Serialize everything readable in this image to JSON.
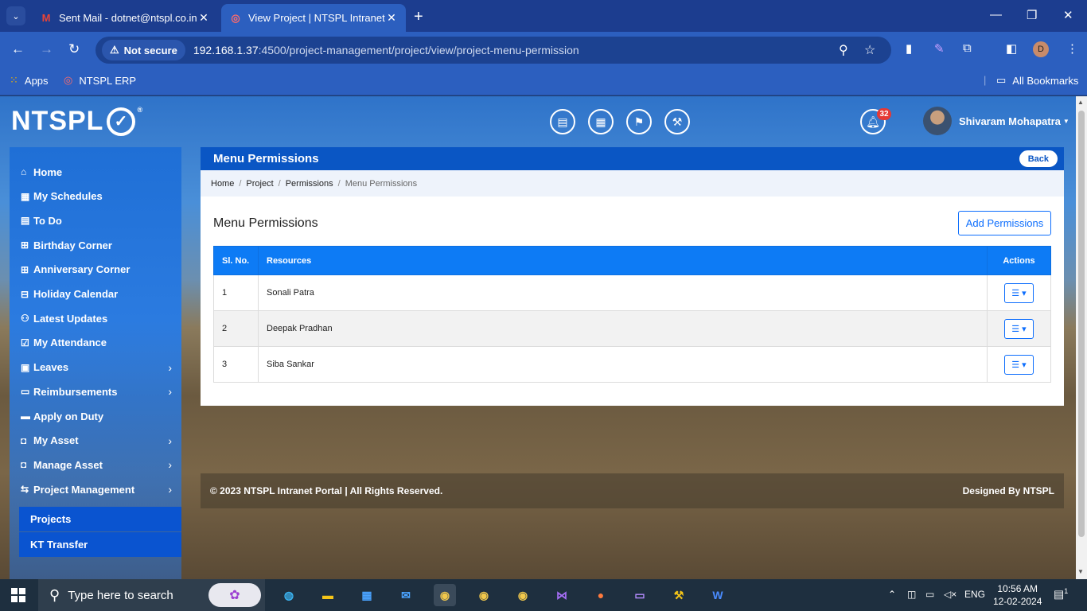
{
  "browser": {
    "tabs": [
      {
        "title": "Sent Mail - dotnet@ntspl.co.in",
        "favicon": "gmail-icon"
      },
      {
        "title": "View Project | NTSPL Intranet",
        "favicon": "ntspl-icon"
      }
    ],
    "security_label": "Not secure",
    "url_host": "192.168.1.37",
    "url_rest": ":4500/project-management/project/view/project-menu-permission",
    "profile_initial": "D",
    "bookmarks": [
      {
        "label": "Apps"
      },
      {
        "label": "NTSPL ERP"
      }
    ],
    "all_bookmarks": "All Bookmarks"
  },
  "header": {
    "logo_text": "NTSPL",
    "logo_reg": "®",
    "notification_count": "32",
    "user_name": "Shivaram Mohapatra"
  },
  "sidebar": {
    "items": [
      {
        "label": "Home",
        "icon": "home-icon",
        "glyph": "⌂"
      },
      {
        "label": "My Schedules",
        "icon": "calendar-icon",
        "glyph": "▦"
      },
      {
        "label": "To Do",
        "icon": "todo-icon",
        "glyph": "▤"
      },
      {
        "label": "Birthday Corner",
        "icon": "gift-icon",
        "glyph": "⊞"
      },
      {
        "label": "Anniversary Corner",
        "icon": "gift-icon",
        "glyph": "⊞"
      },
      {
        "label": "Holiday Calendar",
        "icon": "table-calendar-icon",
        "glyph": "⊟"
      },
      {
        "label": "Latest Updates",
        "icon": "people-icon",
        "glyph": "⚇"
      },
      {
        "label": "My Attendance",
        "icon": "calendar-check-icon",
        "glyph": "☑"
      },
      {
        "label": "Leaves",
        "icon": "calendar-x-icon",
        "glyph": "▣"
      },
      {
        "label": "Reimbursements",
        "icon": "cash-icon",
        "glyph": "▭"
      },
      {
        "label": "Apply on Duty",
        "icon": "briefcase-icon",
        "glyph": "▬"
      },
      {
        "label": "My Asset",
        "icon": "bag-icon",
        "glyph": "◘"
      },
      {
        "label": "Manage Asset",
        "icon": "bag-icon",
        "glyph": "◘"
      },
      {
        "label": "Project Management",
        "icon": "arrows-icon",
        "glyph": "⇆"
      }
    ],
    "sub_items": [
      {
        "label": "Projects"
      },
      {
        "label": "KT Transfer"
      }
    ]
  },
  "content": {
    "panel_title": "Menu Permissions",
    "back_label": "Back",
    "breadcrumb": [
      "Home",
      "Project",
      "Permissions",
      "Menu Permissions"
    ],
    "card_title": "Menu Permissions",
    "add_button": "Add Permissions",
    "table": {
      "headers": [
        "Sl. No.",
        "Resources",
        "Actions"
      ],
      "rows": [
        {
          "sl": "1",
          "resource": "Sonali Patra"
        },
        {
          "sl": "2",
          "resource": "Deepak Pradhan"
        },
        {
          "sl": "3",
          "resource": "Siba Sankar"
        }
      ]
    }
  },
  "footer": {
    "copyright": "© 2023 NTSPL Intranet Portal | All Rights Reserved.",
    "designed_by": "Designed By NTSPL"
  },
  "taskbar": {
    "search_placeholder": "Type here to search",
    "language": "ENG",
    "time": "10:56 AM",
    "date": "12-02-2024",
    "notification_count": "1"
  },
  "colors": {
    "primary": "#0d6efd",
    "header_blue": "#0a56c4",
    "sidebar_active": "#0a54d0",
    "badge_red": "#e53935"
  }
}
